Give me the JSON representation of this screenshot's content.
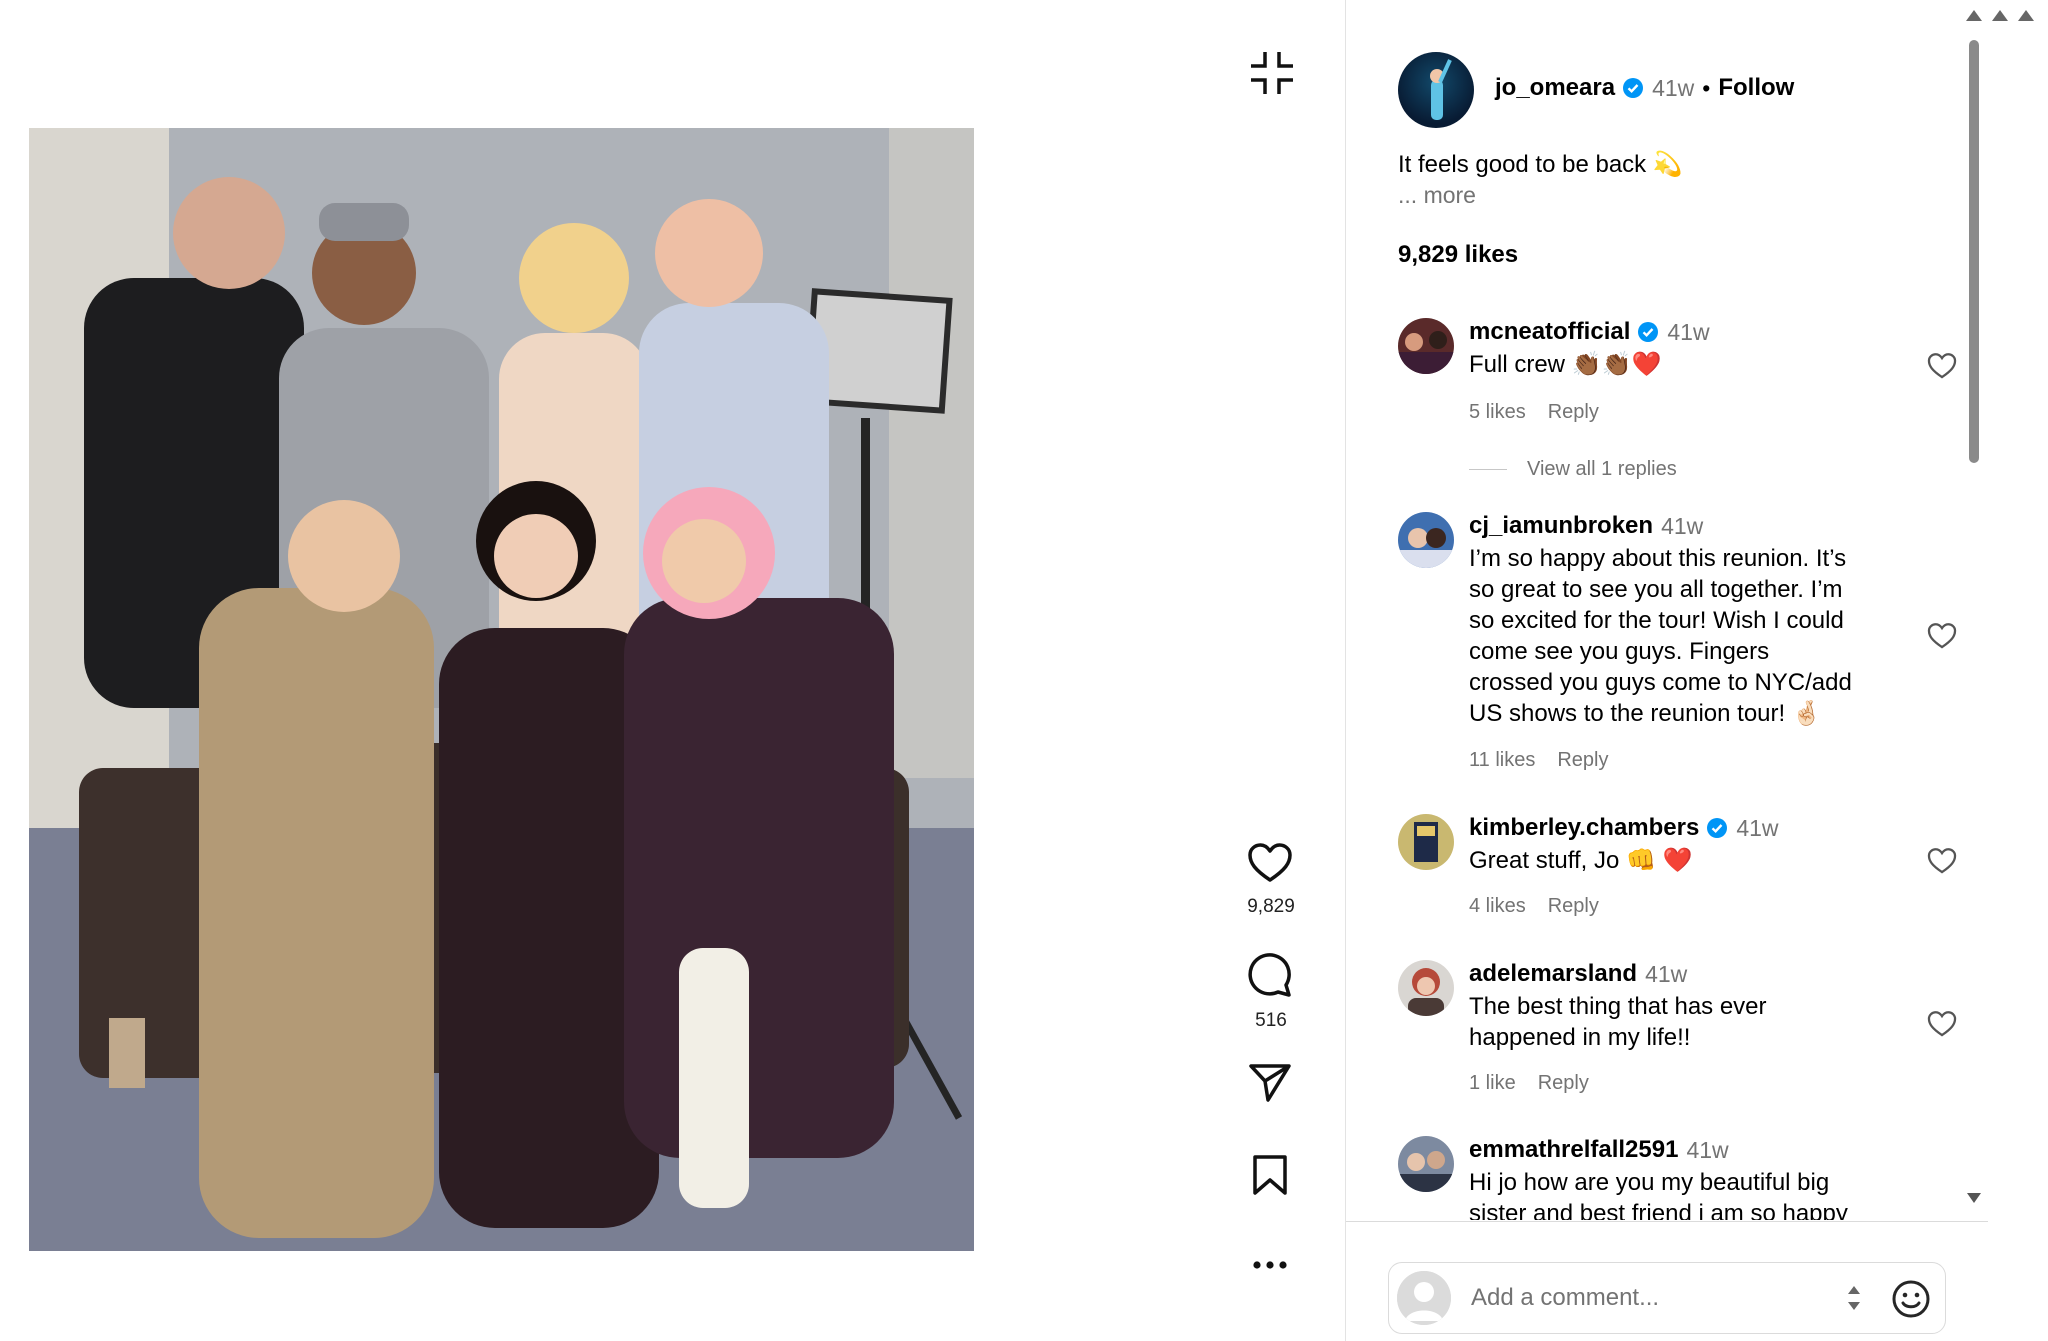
{
  "post": {
    "author": {
      "username": "jo_omeara",
      "age": "41w",
      "separator": "•",
      "follow_label": "Follow"
    },
    "caption": "It feels good to be back 💫",
    "caption_ellipsis": "...",
    "more_label": "more",
    "likes_label": "9,829 likes"
  },
  "actions": {
    "like_count": "9,829",
    "comment_count": "516"
  },
  "comments": [
    {
      "username": "mcneatofficial",
      "verified": true,
      "age": "41w",
      "text": "Full crew 👏🏾👏🏾❤️",
      "likes": "5 likes",
      "reply": "Reply"
    },
    {
      "username": "cj_iamunbroken",
      "verified": false,
      "age": "41w",
      "text": "I’m so happy about this reunion. It’s so great to see you all together. I’m so excited for the tour! Wish I could come see you guys. Fingers crossed you guys come to NYC/add US shows to the reunion tour! 🤞🏻",
      "likes": "11 likes",
      "reply": "Reply"
    },
    {
      "username": "kimberley.chambers",
      "verified": true,
      "age": "41w",
      "text": "Great stuff, Jo 👊 ❤️",
      "likes": "4 likes",
      "reply": "Reply"
    },
    {
      "username": "adelemarsland",
      "verified": false,
      "age": "41w",
      "text": "The best thing that has ever happened in my life!!",
      "likes": "1 like",
      "reply": "Reply"
    },
    {
      "username": "emmathrelfall2591",
      "verified": false,
      "age": "41w",
      "text": "Hi jo how are you my beautiful big sister and best friend i am so happy",
      "likes": "",
      "reply": ""
    }
  ],
  "replies_toggle": "View all 1 replies",
  "composer": {
    "placeholder": "Add a comment..."
  },
  "colors": {
    "accent": "#0095f6",
    "muted": "#737373",
    "divider": "#dbdbdb"
  },
  "icons": [
    "exit-fullscreen-icon",
    "heart-icon",
    "comment-icon",
    "share-icon",
    "bookmark-icon",
    "more-icon",
    "verified-icon",
    "emoji-icon"
  ]
}
